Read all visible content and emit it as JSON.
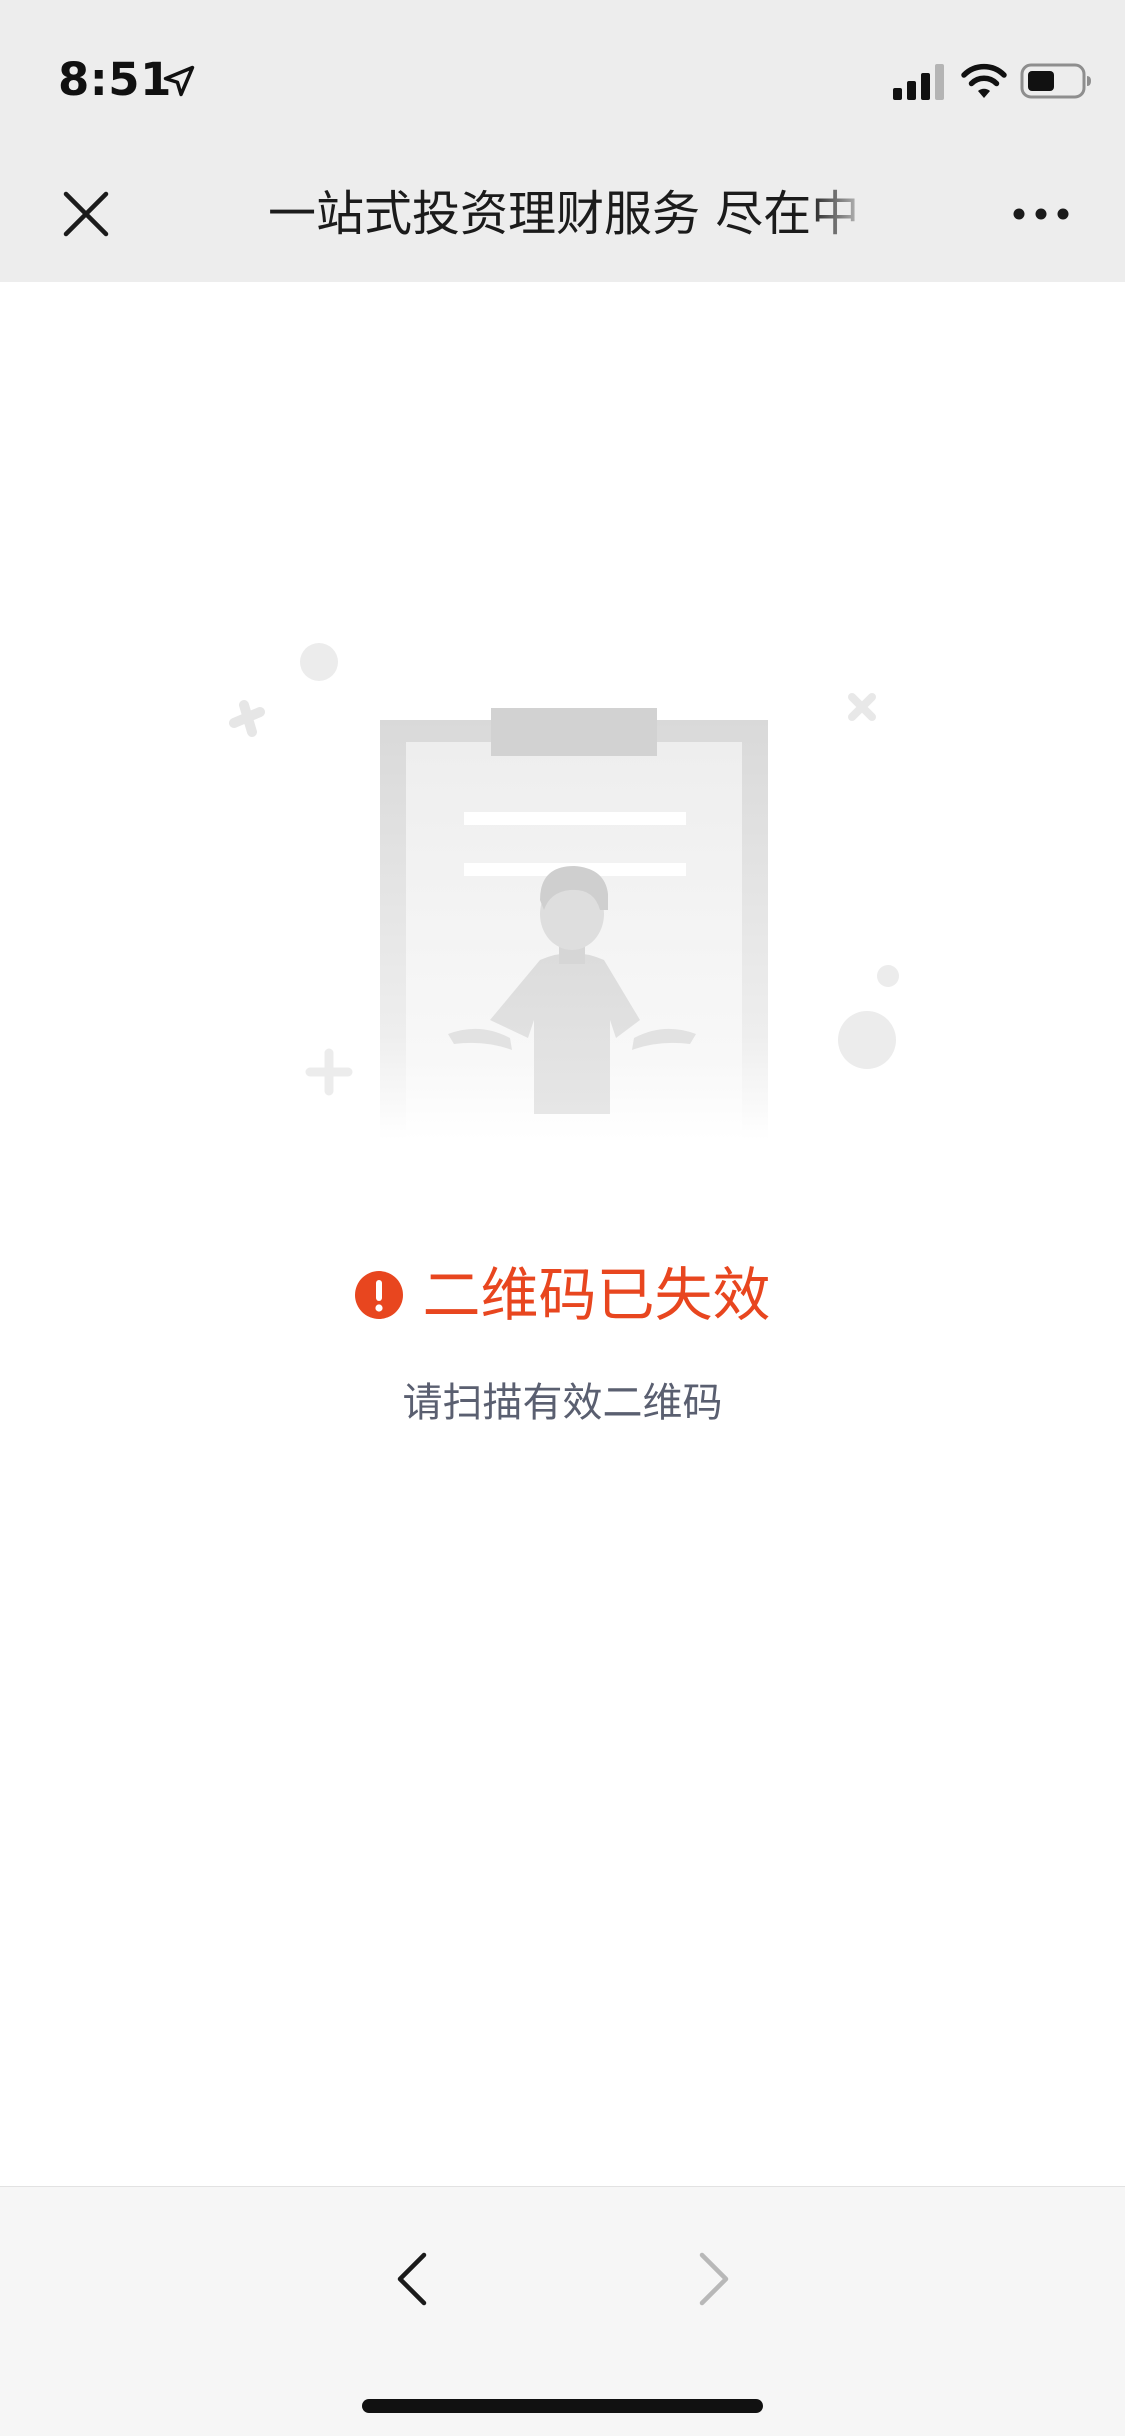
{
  "status_bar": {
    "time": "8:51",
    "location_icon": "location-arrow-icon",
    "signal_icon": "cellular-signal-icon",
    "wifi_icon": "wifi-icon",
    "battery_icon": "battery-icon",
    "battery_level": 0.5
  },
  "nav": {
    "close_icon": "close-icon",
    "title": "一站式投资理财服务 尽在中",
    "more_icon": "more-dots-icon"
  },
  "content": {
    "illustration": "confused-person-clipboard-illustration",
    "alert_icon": "exclamation-circle-icon",
    "error_title": "二维码已失效",
    "error_subtitle": "请扫描有效二维码"
  },
  "toolbar": {
    "back_icon": "chevron-left-icon",
    "forward_icon": "chevron-right-icon",
    "forward_enabled": false
  },
  "colors": {
    "error": "#e8461f",
    "subtitle": "#5a5f70",
    "chrome_bg": "#ededed",
    "toolbar_bg": "#f6f6f6"
  }
}
